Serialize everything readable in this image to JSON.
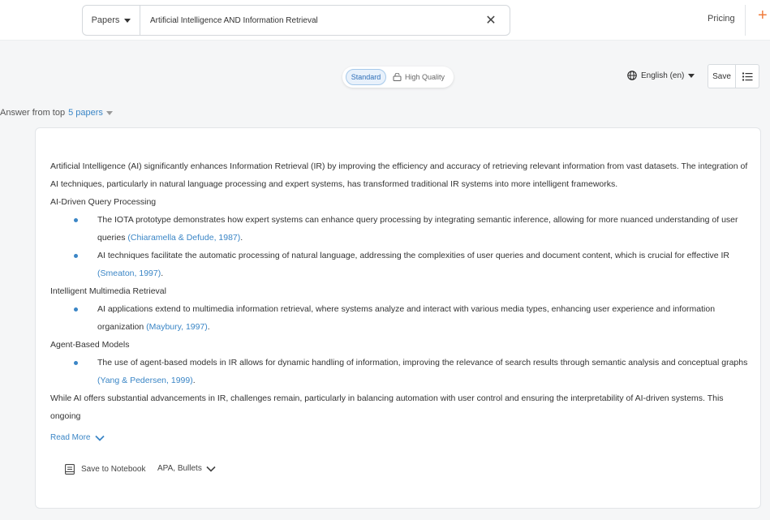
{
  "header": {
    "search_type": "Papers",
    "search_query": "Artificial Intelligence AND Information Retrieval",
    "clear_symbol": "✕",
    "pricing_label": "Pricing",
    "plus_symbol": "+"
  },
  "toolbar": {
    "mode_standard": "Standard",
    "mode_high_quality": "High Quality",
    "language": "English (en)",
    "save_label": "Save"
  },
  "answer_source": {
    "prefix": "Answer from top",
    "link": "5 papers"
  },
  "answer": {
    "intro": "Artificial Intelligence (AI) significantly enhances Information Retrieval (IR) by improving the efficiency and accuracy of retrieving relevant information from vast datasets. The integration of AI techniques, particularly in natural language processing and expert systems, has transformed traditional IR systems into more intelligent frameworks.",
    "sections": [
      {
        "heading": "AI-Driven Query Processing",
        "bullets": [
          {
            "text": "The IOTA prototype demonstrates how expert systems can enhance query processing by integrating semantic inference, allowing for more nuanced understanding of user queries ",
            "cite": "(Chiaramella & Defude, 1987)",
            "end": "."
          },
          {
            "text": "AI techniques facilitate the automatic processing of natural language, addressing the complexities of user queries and document content, which is crucial for effective IR ",
            "cite": "(Smeaton, 1997)",
            "end": "."
          }
        ]
      },
      {
        "heading": "Intelligent Multimedia Retrieval",
        "bullets": [
          {
            "text": "AI applications extend to multimedia information retrieval, where systems analyze and interact with various media types, enhancing user experience and information organization ",
            "cite": "(Maybury, 1997)",
            "end": "."
          }
        ]
      },
      {
        "heading": "Agent-Based Models",
        "bullets": [
          {
            "text": "The use of agent-based models in IR allows for dynamic handling of information, improving the relevance of search results through semantic analysis and conceptual graphs ",
            "cite": "(Yang & Pedersen, 1999)",
            "end": "."
          }
        ]
      }
    ],
    "conclusion": "While AI offers substantial advancements in IR, challenges remain, particularly in balancing automation with user control and ensuring the interpretability of AI-driven systems. This ongoing",
    "read_more": "Read More"
  },
  "actions": {
    "save_notebook": "Save to Notebook",
    "citation_style": "APA, Bullets"
  },
  "colors": {
    "accent": "#3b86c6",
    "brand_orange": "#f07b3b"
  }
}
